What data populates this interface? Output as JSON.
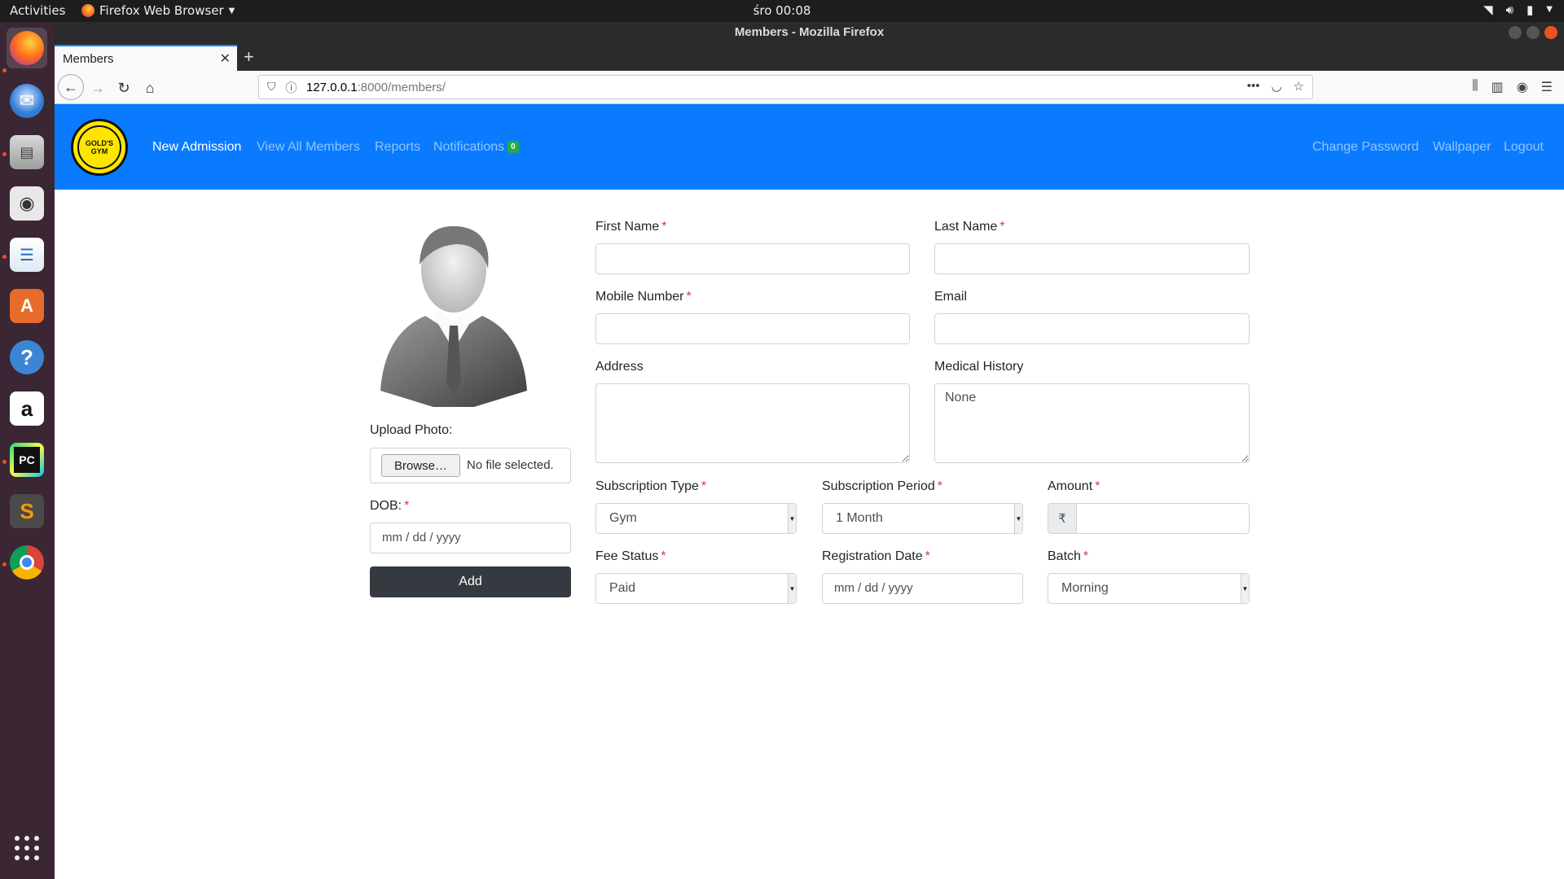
{
  "topbar": {
    "activities": "Activities",
    "app_menu": "Firefox Web Browser",
    "clock": "śro 00:08"
  },
  "dock": {
    "items": [
      {
        "name": "firefox",
        "color": "#e8643c"
      },
      {
        "name": "thunderbird",
        "color": "#2f7bd6"
      },
      {
        "name": "files",
        "color": "#bdbdbd"
      },
      {
        "name": "rhythmbox",
        "color": "#e8e8e8"
      },
      {
        "name": "libreoffice-writer",
        "color": "#1f6fbf"
      },
      {
        "name": "ubuntu-software",
        "color": "#e76b2b"
      },
      {
        "name": "help",
        "color": "#3a86d4"
      },
      {
        "name": "amazon",
        "color": "#ffffff"
      },
      {
        "name": "pycharm",
        "color": "#0d0d0d"
      },
      {
        "name": "sublime-text",
        "color": "#4a4a4a"
      },
      {
        "name": "chrome",
        "color": "#ffffff"
      }
    ]
  },
  "browser": {
    "window_title": "Members - Mozilla Firefox",
    "tab_title": "Members",
    "url_host": "127.0.0.1",
    "url_rest": ":8000/members/"
  },
  "site": {
    "logo_text": "GOLD'S GYM",
    "nav": {
      "new_admission": "New Admission",
      "view_all_members": "View All Members",
      "reports": "Reports",
      "notifications": "Notifications",
      "notifications_count": "0",
      "change_password": "Change Password",
      "wallpaper": "Wallpaper",
      "logout": "Logout"
    },
    "accent": "#0a7bff"
  },
  "form": {
    "first_name_label": "First Name",
    "last_name_label": "Last Name",
    "mobile_label": "Mobile Number",
    "email_label": "Email",
    "address_label": "Address",
    "medical_history_label": "Medical History",
    "medical_history_value": "None",
    "subscription_type_label": "Subscription Type",
    "subscription_type_value": "Gym",
    "subscription_period_label": "Subscription Period",
    "subscription_period_value": "1 Month",
    "amount_label": "Amount",
    "amount_prefix": "₹",
    "fee_status_label": "Fee Status",
    "fee_status_value": "Paid",
    "registration_date_label": "Registration Date",
    "registration_date_placeholder": "mm / dd / yyyy",
    "batch_label": "Batch",
    "batch_value": "Morning",
    "upload_photo_label": "Upload Photo:",
    "browse_label": "Browse…",
    "no_file": "No file selected.",
    "dob_label": "DOB:",
    "dob_placeholder": "mm / dd / yyyy",
    "add_button": "Add",
    "required_mark": "*"
  }
}
